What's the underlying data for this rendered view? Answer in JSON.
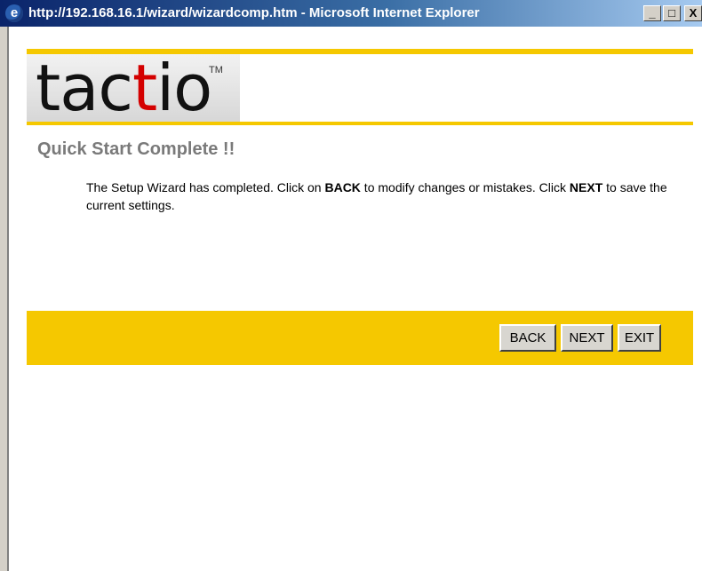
{
  "window": {
    "title": "http://192.168.16.1/wizard/wizardcomp.htm - Microsoft Internet Explorer",
    "minimize_glyph": "_",
    "maximize_glyph": "□",
    "close_glyph": "X"
  },
  "logo": {
    "prefix": "tac",
    "accent": "t",
    "suffix": "io",
    "trademark": "TM",
    "accent_color": "#d40000"
  },
  "page": {
    "heading": "Quick Start Complete !!",
    "description": {
      "part1": "The Setup Wizard has completed. Click on ",
      "back_word": "BACK",
      "part2": " to modify changes or mistakes. Click ",
      "next_word": "NEXT",
      "part3": " to save the current settings."
    }
  },
  "buttons": {
    "back": "BACK",
    "next": "NEXT",
    "exit": "EXIT"
  },
  "colors": {
    "brand_yellow": "#f5c800",
    "heading_gray": "#7a7a7a"
  }
}
